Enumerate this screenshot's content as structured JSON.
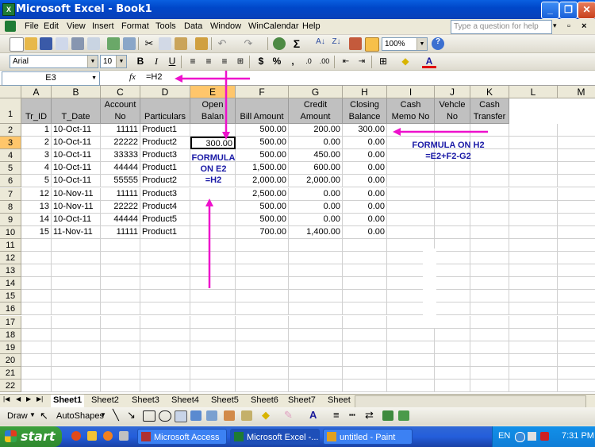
{
  "window": {
    "title": "Microsoft Excel - Book1",
    "app_icon": "excel-icon"
  },
  "menu": {
    "items": [
      "File",
      "Edit",
      "View",
      "Insert",
      "Format",
      "Tools",
      "Data",
      "Window",
      "WinCalendar",
      "Help"
    ],
    "question_placeholder": "Type a question for help"
  },
  "toolbar": {
    "zoom": "100%"
  },
  "formatting": {
    "font_name": "Arial",
    "font_size": "10"
  },
  "formula_bar": {
    "name_box": "E3",
    "fx_label": "fx",
    "formula": "=H2"
  },
  "grid": {
    "columns": [
      "A",
      "B",
      "C",
      "D",
      "E",
      "F",
      "G",
      "H",
      "I",
      "J",
      "K",
      "L",
      "M"
    ],
    "headers": [
      "Tr_ID",
      "T_Date",
      "Account No",
      "Particulars",
      "Opening Balance",
      "Bill Amount",
      "Credit Amount",
      "Closing Balance",
      "Cash Memo No",
      "Vehcle No",
      "Cash Transfer"
    ],
    "header_visible": [
      "Tr_ID",
      "T_Date",
      "Account\nNo",
      "Particulars",
      "Open\nBalan",
      "Bill Amount",
      "Credit\nAmount",
      "Closing\nBalance",
      "Cash\nMemo No",
      "Vehcle\nNo",
      "Cash\nTransfer"
    ],
    "rows": [
      [
        "1",
        "10-Oct-11",
        "11111",
        "Product1",
        "",
        "500.00",
        "200.00",
        "300.00"
      ],
      [
        "2",
        "10-Oct-11",
        "22222",
        "Product2",
        "300.00",
        "500.00",
        "0.00",
        "0.00"
      ],
      [
        "3",
        "10-Oct-11",
        "33333",
        "Product3",
        "",
        "500.00",
        "450.00",
        "0.00"
      ],
      [
        "4",
        "10-Oct-11",
        "44444",
        "Product1",
        "",
        "1,500.00",
        "600.00",
        "0.00"
      ],
      [
        "5",
        "10-Oct-11",
        "55555",
        "Product2",
        "",
        "2,000.00",
        "2,000.00",
        "0.00"
      ],
      [
        "12",
        "10-Nov-11",
        "11111",
        "Product3",
        "",
        "2,500.00",
        "0.00",
        "0.00"
      ],
      [
        "13",
        "10-Nov-11",
        "22222",
        "Product4",
        "",
        "500.00",
        "0.00",
        "0.00"
      ],
      [
        "14",
        "10-Oct-11",
        "44444",
        "Product5",
        "",
        "500.00",
        "0.00",
        "0.00"
      ],
      [
        "15",
        "11-Nov-11",
        "11111",
        "Product1",
        "",
        "700.00",
        "1,400.00",
        "0.00"
      ]
    ],
    "row_numbers": [
      "1",
      "2",
      "3",
      "4",
      "5",
      "6",
      "7",
      "8",
      "9",
      "10",
      "11",
      "12",
      "13",
      "14",
      "15",
      "16",
      "17",
      "18",
      "19",
      "20",
      "21",
      "22"
    ]
  },
  "annotations": {
    "h2_note_line1": "FORMULA ON  H2",
    "h2_note_line2": "=E2+F2-G2",
    "e2_note_line1": "FORMULA",
    "e2_note_line2": "ON E2",
    "e2_note_line3": "=H2",
    "arrow_color": "#ee11cc"
  },
  "sheets": {
    "tabs": [
      "Sheet1",
      "Sheet2",
      "Sheet3",
      "Sheet4",
      "Sheet5",
      "Sheet6",
      "Sheet7",
      "Sheet"
    ],
    "active": "Sheet1"
  },
  "drawing": {
    "draw_label": "Draw",
    "autoshapes_label": "AutoShapes"
  },
  "taskbar": {
    "start_label": "start",
    "tasks": [
      "Microsoft Access",
      "Microsoft Excel -...",
      "untitled - Paint"
    ],
    "language": "EN",
    "clock": "7:31 PM"
  }
}
